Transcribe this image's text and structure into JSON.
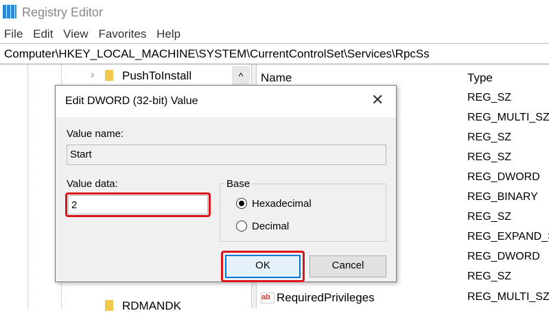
{
  "window": {
    "title": "Registry Editor"
  },
  "menu": [
    "File",
    "Edit",
    "View",
    "Favorites",
    "Help"
  ],
  "address": "Computer\\HKEY_LOCAL_MACHINE\\SYSTEM\\CurrentControlSet\\Services\\RpcSs",
  "tree": {
    "items": [
      "PushToInstall",
      "RDMANDK"
    ]
  },
  "list": {
    "header_name": "Name",
    "header_type": "Type",
    "types": [
      "REG_SZ",
      "REG_MULTI_SZ",
      "REG_SZ",
      "REG_SZ",
      "REG_DWORD",
      "REG_BINARY",
      "REG_SZ",
      "REG_EXPAND_SZ",
      "REG_DWORD",
      "REG_SZ",
      "REG_MULTI_SZ"
    ],
    "visible_name": "RequiredPrivileges"
  },
  "dialog": {
    "title": "Edit DWORD (32-bit) Value",
    "value_name_label": "Value name:",
    "value_name": "Start",
    "value_data_label": "Value data:",
    "value_data": "2",
    "base_label": "Base",
    "hex_label": "Hexadecimal",
    "dec_label": "Decimal",
    "selected_base": "Hexadecimal",
    "ok": "OK",
    "cancel": "Cancel"
  },
  "colors": {
    "highlight": "#d9141b",
    "focus": "#0078d7"
  }
}
